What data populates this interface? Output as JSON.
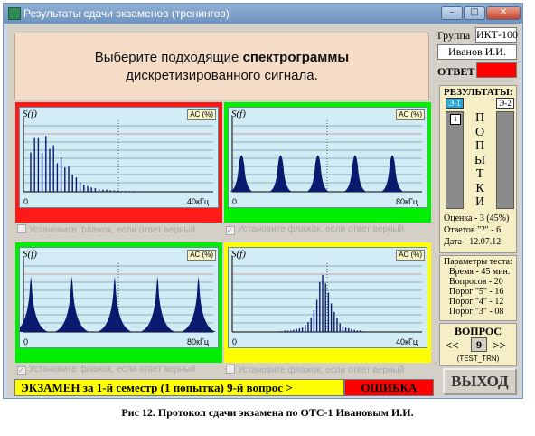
{
  "window": {
    "title": "Результаты сдачи экзаменов (тренингов)"
  },
  "question": {
    "line1_prefix": "Выберите подходящие ",
    "line1_bold": "спектрограммы",
    "line2": "дискретизированного сигнала."
  },
  "panels": [
    {
      "id": "top-left",
      "bg": "#ff1a1a",
      "axis_end": "40кГц",
      "checkbox_label": "Установите флажок, если ответ верный",
      "checked": false,
      "lines": [
        0.55,
        0.75,
        0.75,
        0.55,
        0.78,
        0.6,
        0.65,
        0.4,
        0.48,
        0.34,
        0.35,
        0.24,
        0.2,
        0.14,
        0.1,
        0.08,
        0.06,
        0.05,
        0.04,
        0.03,
        0.03,
        0.02,
        0.02,
        0.02,
        0.01,
        0.01,
        0.01,
        0.01
      ]
    },
    {
      "id": "top-right",
      "bg": "#00ee00",
      "axis_end": "80кГц",
      "checkbox_label": "Установите флажок, если ответ верный",
      "checked": true,
      "peaks": [
        0.04,
        0.25,
        0.45,
        0.65,
        0.85
      ],
      "peak_height": 0.6
    },
    {
      "id": "bottom-left",
      "bg": "#00ee00",
      "axis_end": "80кГц",
      "checkbox_label": "Установите флажок, если ответ верный",
      "checked": true,
      "spikes": [
        0.03,
        0.25,
        0.48,
        0.71,
        0.93
      ],
      "spike_height": 0.78
    },
    {
      "id": "bottom-right",
      "bg": "#ffff00",
      "axis_end": "40кГц",
      "checkbox_label": "Установите флажок, если ответ верный",
      "checked": false,
      "lines": [
        0.01,
        0.01,
        0.02,
        0.02,
        0.02,
        0.03,
        0.04,
        0.05,
        0.06,
        0.1,
        0.14,
        0.2,
        0.3,
        0.45,
        0.7,
        0.8,
        0.68,
        0.55,
        0.4,
        0.28,
        0.2,
        0.12,
        0.08,
        0.06,
        0.05,
        0.04,
        0.03,
        0.02,
        0.02,
        0.01
      ]
    }
  ],
  "labels": {
    "sf": "S(f)",
    "ac": "AC (%)",
    "zero": "0"
  },
  "status": {
    "exam_text": "ЭКЗАМЕН за 1-й семестр (1 попытка) 9-й вопрос >",
    "result": "ОШИБКА"
  },
  "side": {
    "group_label": "Группа",
    "group_value": "ИКТ-100",
    "student": "Иванов И.И.",
    "answer_label": "ОТВЕТ",
    "answer_color": "#ff0000"
  },
  "results": {
    "title": "РЕЗУЛЬТАТЫ:",
    "e1": "Э-1",
    "e2": "Э-2",
    "attempt_marker": "1",
    "attempts_word": "П О П Ы Т К И",
    "grade": "Оценка - 3 (45%)",
    "wrong": "Ответов \"?\" - 6",
    "date": "Дата - 12.07.12"
  },
  "params": {
    "title": "Параметры теста:",
    "time": "Время - 45 мин.",
    "questions": "Вопросов - 20",
    "p5": "Порог \"5\" - 16",
    "p4": "Порог \"4\" - 12",
    "p3": "Порог \"3\" - 08"
  },
  "qnav": {
    "title": "ВОПРОС",
    "prev": "<<",
    "next": ">>",
    "number": "9",
    "code": "(TEST_TRN)"
  },
  "exit_label": "ВЫХОД",
  "caption": "Рис 12. Протокол сдачи экзамена по ОТС-1 Ивановым И.И."
}
